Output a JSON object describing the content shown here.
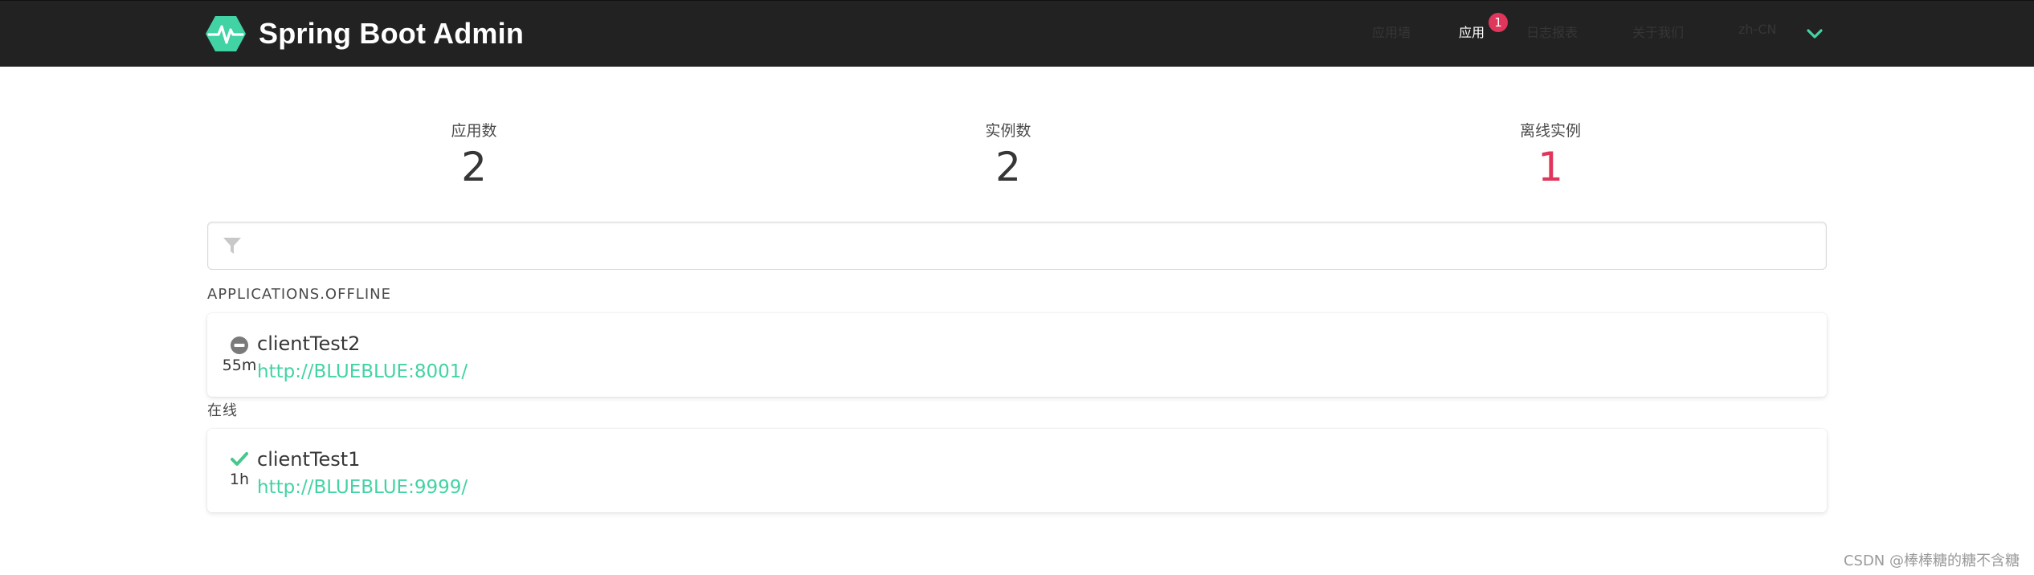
{
  "brand": {
    "name": "Spring Boot Admin"
  },
  "nav": {
    "items": [
      {
        "label": "应用墙",
        "active": false
      },
      {
        "label": "应用",
        "active": true,
        "badge": "1"
      },
      {
        "label": "日志报表",
        "active": false
      },
      {
        "label": "关于我们",
        "active": false
      }
    ],
    "language": "zh-CN"
  },
  "stats": [
    {
      "label": "应用数",
      "value": "2"
    },
    {
      "label": "实例数",
      "value": "2"
    },
    {
      "label": "离线实例",
      "value": "1"
    }
  ],
  "filter": {
    "placeholder": "",
    "value": ""
  },
  "groups": {
    "offline": {
      "title": "APPLICATIONS.OFFLINE",
      "app": {
        "name": "clientTest2",
        "url": "http://BLUEBLUE:8001/",
        "since": "55m",
        "status_icon": "minus-circle-icon"
      }
    },
    "online": {
      "title": "在线",
      "app": {
        "name": "clientTest1",
        "url": "http://BLUEBLUE:9999/",
        "since": "1h",
        "status_icon": "check-icon"
      }
    }
  },
  "watermark": "CSDN @棒棒糖的糖不含糖",
  "colors": {
    "navbar": "#222222",
    "accent": "#42d3a5",
    "danger": "#e0365b",
    "offline_icon": "#7a7a7a",
    "online_icon": "#48c78e"
  }
}
